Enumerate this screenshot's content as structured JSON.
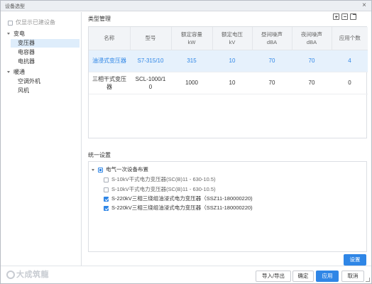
{
  "window": {
    "title": "设备选型",
    "close_glyph": "×"
  },
  "left_panel": {
    "show_created_label": "仅显示已建设备",
    "tree": [
      {
        "label": "变电",
        "level": 0,
        "expanded": true
      },
      {
        "label": "变压器",
        "level": 1,
        "selected": true
      },
      {
        "label": "电容器",
        "level": 1
      },
      {
        "label": "电抗器",
        "level": 1
      },
      {
        "label": "暖通",
        "level": 0,
        "expanded": true
      },
      {
        "label": "空调外机",
        "level": 1
      },
      {
        "label": "风机",
        "level": 1
      }
    ]
  },
  "type_mgmt": {
    "title": "类型管理",
    "toolbar_icons": [
      "add-icon",
      "remove-icon",
      "export-icon"
    ],
    "columns": [
      "名称",
      "型号",
      "额定容量\nkW",
      "额定电压\nkV",
      "昼间噪声\ndBA",
      "夜间噪声\ndBA",
      "应用个数"
    ],
    "rows": [
      {
        "cells": [
          "油浸式变压器",
          "S7-315/10",
          "315",
          "10",
          "70",
          "70",
          "4"
        ],
        "selected": true
      },
      {
        "cells": [
          "三相干式变压\n器",
          "SCL-1000/1\n0",
          "1000",
          "10",
          "70",
          "70",
          "0"
        ],
        "selected": false
      }
    ]
  },
  "unified": {
    "title": "统一设置",
    "root_label": "电气一次设备布置",
    "items": [
      {
        "label": "S-10kV干式电力变压器(SC(B)11 - 630-10.5)",
        "checked": false
      },
      {
        "label": "S-10kV干式电力变压器(SC(B)11 - 630-10.5)",
        "checked": false
      },
      {
        "label": "S-220kV三相三绕组油浸式电力变压器（SSZ11-180000220)",
        "checked": true
      },
      {
        "label": "S-220kV三相三绕组油浸式电力变压器（SSZ11-180000220)",
        "checked": true
      }
    ],
    "settings_button": "设置"
  },
  "footer": {
    "logo_text": "大成筑龍",
    "import_export": "导入/导出",
    "ok": "确定",
    "apply": "应用",
    "cancel": "取消"
  },
  "colors": {
    "accent": "#2f86e6",
    "selected_row": "#e6f1fc",
    "header_bg": "#f2f4f7"
  }
}
